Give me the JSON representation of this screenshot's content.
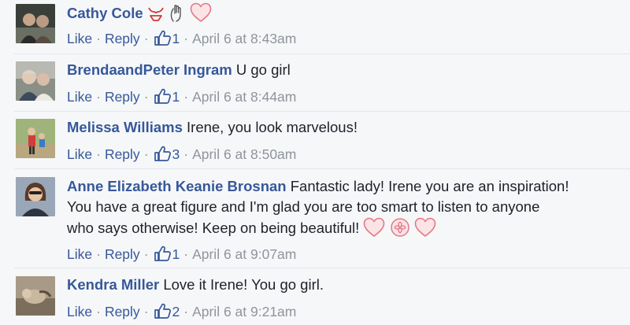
{
  "comments": [
    {
      "author": "Cathy Cole",
      "text": "",
      "like_label": "Like",
      "reply_label": "Reply",
      "like_count": "1",
      "timestamp": "April 6 at 8:43am"
    },
    {
      "author": "BrendaandPeter Ingram",
      "text": "U go girl",
      "like_label": "Like",
      "reply_label": "Reply",
      "like_count": "1",
      "timestamp": "April 6 at 8:44am"
    },
    {
      "author": "Melissa Williams",
      "text": "Irene, you look marvelous!",
      "like_label": "Like",
      "reply_label": "Reply",
      "like_count": "3",
      "timestamp": "April 6 at 8:50am"
    },
    {
      "author": "Anne Elizabeth Keanie Brosnan",
      "text_line1": "Fantastic lady! Irene you are an inspiration!",
      "text_line2": "You have a great figure and I'm glad you are too smart to listen to anyone",
      "text_line3": "who says otherwise! Keep on being beautiful!",
      "like_label": "Like",
      "reply_label": "Reply",
      "like_count": "1",
      "timestamp": "April 6 at 9:07am"
    },
    {
      "author": "Kendra Miller",
      "text": "Love it Irene! You go girl.",
      "like_label": "Like",
      "reply_label": "Reply",
      "like_count": "2",
      "timestamp": "April 6 at 9:21am"
    }
  ],
  "separator": "·",
  "colors": {
    "link": "#365899",
    "text": "#1d2129",
    "muted": "#90949c",
    "heart": "#e8a0a8",
    "background": "#f6f7f9"
  },
  "icons": {
    "like": "thumbs-up-icon",
    "heart": "heart-emoji-icon",
    "bikini": "bikini-emoji-icon",
    "hand": "raised-hand-emoji-icon",
    "flower": "flower-emoji-icon"
  }
}
